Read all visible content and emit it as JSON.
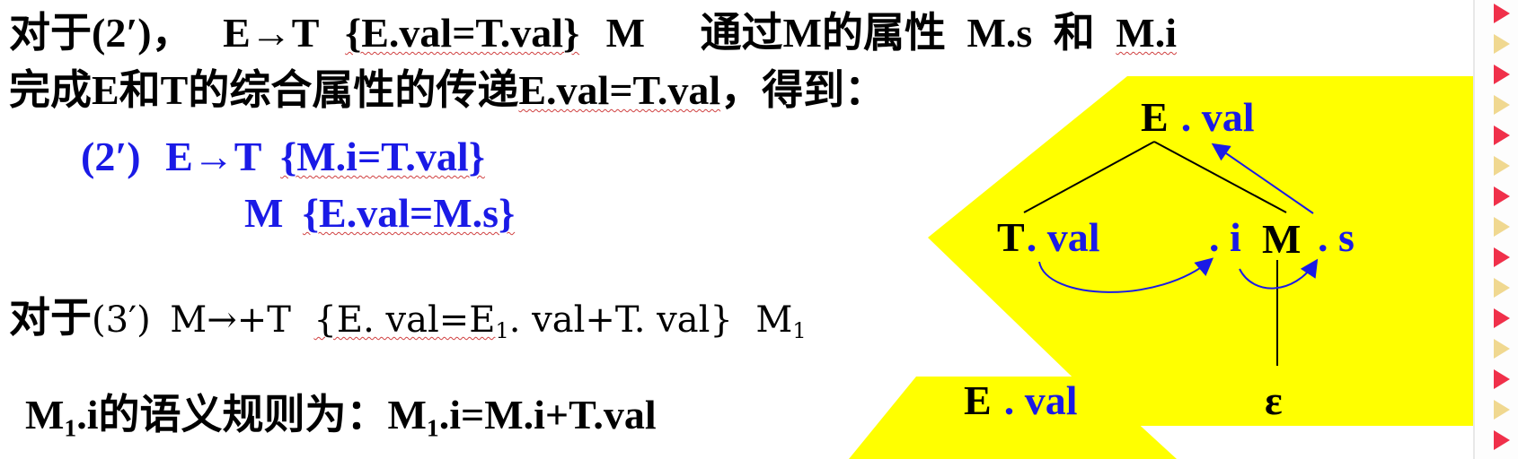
{
  "text": {
    "line1_prefix": "对于(2′)，",
    "line1_rule": "E→T",
    "line1_action": "{E.val=T.val}",
    "line1_m": "M",
    "line1_tail_a": "通过M的属性",
    "line1_ms": "M.s",
    "line1_he": "和",
    "line1_mi": "M.i",
    "line2_a": "完成E和T的综合属性的传递",
    "line2_expr": "E.val=T.val",
    "line2_b": "，得到：",
    "rule2_label": "(2′)",
    "rule2_prod": "E→T",
    "rule2_action": "{M.i=T.val}",
    "rule2b_m": "M",
    "rule2b_action": "{E.val=M.s}",
    "line3_prefix": "对于",
    "line3_paren": "(3′)",
    "line3_prod": "M→+T",
    "line3_action_a": "{E. val=E",
    "line3_sub1": "1",
    "line3_action_b": ". val+T. val}",
    "line3_m": "M",
    "line3_msub": "1",
    "line4_a": "M",
    "line4_sub": "1",
    "line4_b": ".i的语义规则为：M",
    "line4_sub2": "1",
    "line4_c": ".i=M.i+T.val"
  },
  "diagram": {
    "root_E": "E",
    "root_val": ". val",
    "left_T": "T",
    "left_val": ". val",
    "mid_i": ". i",
    "right_M": "M",
    "right_s": ". s",
    "epsilon": "ε",
    "lower_E": "E",
    "lower_val": ". val"
  },
  "colors": {
    "yellow": "#ffff00",
    "blue": "#1a1ae6",
    "red_marker": "#f0304a",
    "tan_marker": "#f0d890"
  }
}
